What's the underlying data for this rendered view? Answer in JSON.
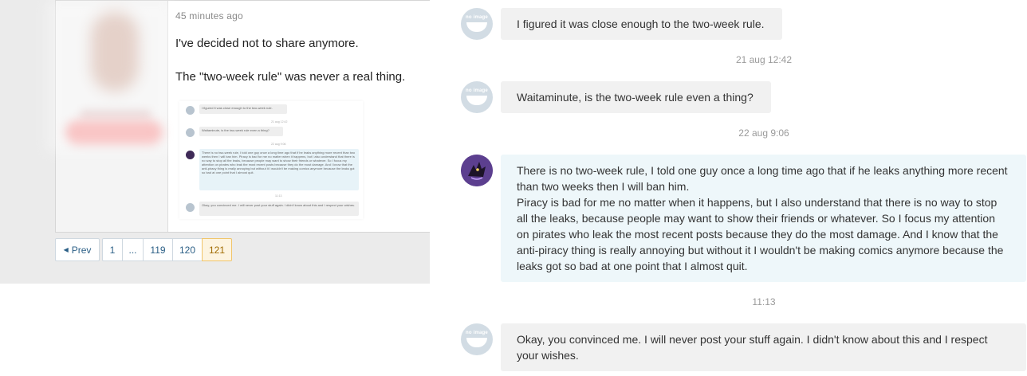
{
  "post": {
    "time": "45 minutes ago",
    "lines": [
      "I've decided not to share anymore.",
      "The \"two-week rule\" was never a real thing."
    ]
  },
  "thumbnail": {
    "messages": [
      "I figured it was close enough to the two-week rule.",
      "Waitaminute, is the two-week rule even a thing?",
      "There is no two-week rule, I told one guy once a long time ago that if he leaks anything more recent than two weeks then I will ban him. Piracy is bad for me no matter when it happens, but I also understand that there is no way to stop all the leaks, because people may want to show their friends or whatever. So I focus my attention on pirates who leak the most recent posts because they do the most damage. And I know that the anti-piracy thing is really annoying but without it I wouldn't be making comics anymore because the leaks got so bad at one point that I almost quit.",
      "Okay, you convinced me. I will never post your stuff again. I didn't know about this and I respect your wishes."
    ],
    "dates": [
      "21 aug 12:42",
      "22 aug 9:06",
      "11:13"
    ]
  },
  "pagination": {
    "prev_label": "Prev",
    "prev_icon": "triangle-left-icon",
    "pages": [
      "1",
      "...",
      "119",
      "120",
      "121"
    ],
    "current": "121",
    "current_color": "#fdf4e0"
  },
  "chat": {
    "avatar_text": "no image",
    "messages": [
      "I figured it was close enough to the two-week rule.",
      "Waitaminute, is the two-week rule even a thing?",
      "There is no two-week rule, I told one guy once a long time ago that if he leaks anything more recent than two weeks then I will ban him.",
      "Piracy is bad for me no matter when it happens, but I also understand that there is no way to stop all the leaks, because people may want to show their friends or whatever. So I focus my attention on pirates who leak the most recent posts because they do the most damage. And I know that the anti-piracy thing is really annoying but without it I wouldn't be making comics anymore because the leaks got so bad at one point that I almost quit.",
      "Okay, you convinced me. I will never post your stuff again. I didn't know about this and I respect your wishes."
    ],
    "timestamps": [
      "21 aug 12:42",
      "22 aug 9:06",
      "11:13"
    ],
    "colors": {
      "bubble_gray": "#f1f1f1",
      "bubble_blue": "#eef7fa",
      "avatar_gray": "#d2dce4",
      "artist_avatar": "#5c3f8f"
    }
  }
}
